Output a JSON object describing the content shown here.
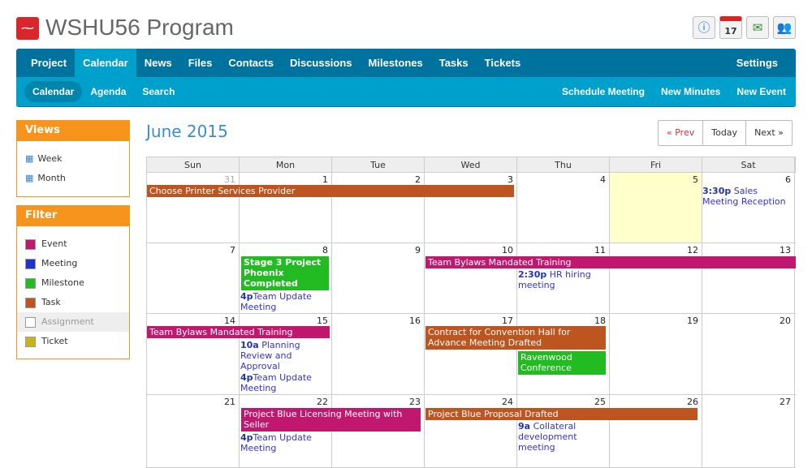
{
  "app": {
    "title": "WSHU56 Program"
  },
  "toolbar": {
    "icons": [
      "info-icon",
      "calendar-icon",
      "export-mail-icon",
      "users-icon"
    ],
    "cal_day": "17"
  },
  "nav": {
    "main": [
      "Project",
      "Calendar",
      "News",
      "Files",
      "Contacts",
      "Discussions",
      "Milestones",
      "Tasks",
      "Tickets"
    ],
    "settings": "Settings",
    "sub": [
      "Calendar",
      "Agenda",
      "Search"
    ],
    "actions": [
      "Schedule Meeting",
      "New Minutes",
      "New Event"
    ]
  },
  "views": {
    "title": "Views",
    "items": [
      "Week",
      "Month"
    ]
  },
  "filter": {
    "title": "Filter",
    "items": [
      {
        "label": "Event",
        "color": "#c0186e"
      },
      {
        "label": "Meeting",
        "color": "#2233cc"
      },
      {
        "label": "Milestone",
        "color": "#22bb22"
      },
      {
        "label": "Task",
        "color": "#bd5520"
      },
      {
        "label": "Assignment",
        "color": "#ffffff"
      },
      {
        "label": "Ticket",
        "color": "#c8b414"
      }
    ]
  },
  "calendar": {
    "month": "June 2015",
    "prev": "« Prev",
    "today": "Today",
    "next": "Next »",
    "weekdays": [
      "Sun",
      "Mon",
      "Tue",
      "Wed",
      "Thu",
      "Fri",
      "Sat"
    ],
    "weeks": [
      [
        "31",
        "1",
        "2",
        "3",
        "4",
        "5",
        "6"
      ],
      [
        "7",
        "8",
        "9",
        "10",
        "11",
        "12",
        "13"
      ],
      [
        "14",
        "15",
        "16",
        "17",
        "18",
        "19",
        "20"
      ],
      [
        "21",
        "22",
        "23",
        "24",
        "25",
        "26",
        "27"
      ]
    ],
    "bars": [
      "Choose Printer Services Provider",
      "Team Bylaws Mandated Training",
      "Stage 3 Project Phoenix Completed",
      "Team Bylaws Mandated Training",
      "Contract for Convention Hall for Advance Meeting Drafted",
      "Ravenwood Conference",
      "Project Blue Licensing Meeting with Seller",
      "Project Blue Proposal Drafted"
    ],
    "timed": [
      {
        "time": "3:30p",
        "title": "Sales Meeting Reception"
      },
      {
        "time": "2:30p",
        "title": "HR hiring meeting"
      },
      {
        "time": "4p",
        "title": "Team Update Meeting"
      },
      {
        "time": "10a",
        "title": "Planning Review and Approval"
      },
      {
        "time": "4p",
        "title": "Team Update Meeting"
      },
      {
        "time": "4p",
        "title": "Team Update Meeting"
      },
      {
        "time": "9a",
        "title": "Collateral development meeting"
      }
    ]
  }
}
